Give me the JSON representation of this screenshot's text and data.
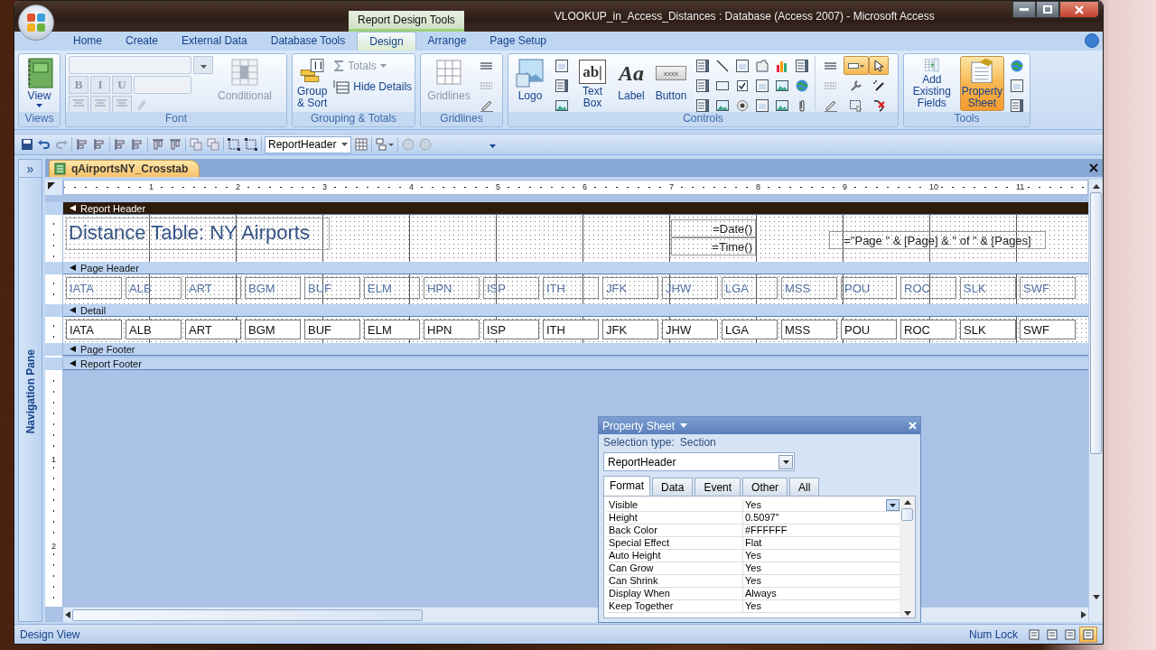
{
  "window": {
    "title": "VLOOKUP_in_Access_Distances : Database (Access 2007)  -  Microsoft Access",
    "context_tab": "Report Design Tools"
  },
  "ribbon_tabs": [
    {
      "label": "Home",
      "selected": false
    },
    {
      "label": "Create",
      "selected": false
    },
    {
      "label": "External Data",
      "selected": false
    },
    {
      "label": "Database Tools",
      "selected": false
    },
    {
      "label": "Design",
      "selected": true
    },
    {
      "label": "Arrange",
      "selected": false
    },
    {
      "label": "Page Setup",
      "selected": false
    }
  ],
  "ribbon_groups": [
    {
      "kind": "views",
      "title": "Views",
      "buttons": [
        {
          "kind": "view",
          "label": "View",
          "disabled": false,
          "selected": false
        }
      ]
    },
    {
      "kind": "font",
      "title": "Font",
      "disabled": true,
      "styles": [
        "B",
        "I",
        "U"
      ],
      "buttons": [
        {
          "kind": "conditional",
          "label": "Conditional",
          "disabled": true,
          "selected": false
        }
      ]
    },
    {
      "kind": "grouping",
      "title": "Grouping & Totals",
      "buttons": [
        {
          "kind": "group-sort",
          "label": "Group\n& Sort",
          "disabled": false,
          "selected": false
        }
      ],
      "small_buttons": [
        {
          "kind": "totals",
          "label": "Totals",
          "disabled": true
        },
        {
          "kind": "hide-details",
          "label": "Hide Details",
          "disabled": false
        }
      ]
    },
    {
      "kind": "gridlines",
      "title": "Gridlines",
      "buttons": [
        {
          "kind": "gridlines",
          "label": "Gridlines",
          "disabled": true,
          "selected": false
        }
      ]
    },
    {
      "kind": "controls",
      "title": "Controls",
      "buttons": [
        {
          "kind": "logo",
          "label": "Logo",
          "disabled": false,
          "selected": false
        },
        {
          "kind": "text-box",
          "label": "Text\nBox",
          "glyph": "ab|",
          "disabled": false,
          "selected": false
        },
        {
          "kind": "label",
          "label": "Label",
          "glyph": "Aa",
          "disabled": false,
          "selected": false
        },
        {
          "kind": "button",
          "label": "Button",
          "glyph": "xxxx",
          "disabled": false,
          "selected": false
        }
      ],
      "tools": [
        {
          "kind": "list",
          "selected": false
        },
        {
          "kind": "line",
          "selected": false
        },
        {
          "kind": "frame",
          "selected": false
        },
        {
          "kind": "tab",
          "selected": false
        },
        {
          "kind": "chart",
          "selected": false
        },
        {
          "kind": "list",
          "selected": false
        },
        {
          "kind": "list",
          "selected": false
        },
        {
          "kind": "rectangle",
          "selected": false
        },
        {
          "kind": "checkbox",
          "selected": false
        },
        {
          "kind": "frame",
          "selected": false
        },
        {
          "kind": "image",
          "selected": false
        },
        {
          "kind": "globe",
          "selected": false
        },
        {
          "kind": "list",
          "selected": false
        },
        {
          "kind": "image",
          "selected": false
        },
        {
          "kind": "option",
          "selected": false
        },
        {
          "kind": "frame",
          "selected": false
        },
        {
          "kind": "image",
          "selected": false
        },
        {
          "kind": "clip",
          "selected": false
        }
      ],
      "format_tools": [
        {
          "kind": "lines",
          "selected": false
        },
        {
          "kind": "wizard",
          "selected": true
        },
        {
          "kind": "pointer",
          "selected": true
        },
        {
          "kind": "dashes",
          "selected": false
        },
        {
          "kind": "wrench",
          "selected": false
        },
        {
          "kind": "wand",
          "selected": false
        },
        {
          "kind": "pen",
          "selected": false
        },
        {
          "kind": "region",
          "selected": false
        },
        {
          "kind": "remove",
          "selected": false
        }
      ]
    },
    {
      "kind": "tools",
      "title": "Tools",
      "buttons": [
        {
          "kind": "add-fields",
          "label": "Add Existing\nFields",
          "disabled": false,
          "selected": false
        },
        {
          "kind": "property-sheet",
          "label": "Property\nSheet",
          "disabled": false,
          "selected": true
        }
      ]
    }
  ],
  "toolbar": {
    "object_selector": "ReportHeader"
  },
  "navigation_pane": {
    "toggle": "»",
    "label": "Navigation Pane"
  },
  "document_tab": {
    "title": "qAirportsNY_Crosstab"
  },
  "ruler": {
    "horizontal": [
      "1",
      "2",
      "3",
      "4",
      "5",
      "6",
      "7",
      "8",
      "9",
      "10",
      "11"
    ],
    "vertical": [
      "1",
      "2"
    ]
  },
  "sections": [
    {
      "kind": "header",
      "title": "Report Header",
      "selected": true,
      "heading": "Distance Table: NY Airports",
      "fields": [
        "=Date()",
        "=Time()"
      ],
      "page_expression": "=\"Page \" & [Page] & \" of \" & [Pages]"
    },
    {
      "kind": "labels",
      "title": "Page Header",
      "selected": false,
      "cells": [
        "IATA",
        "ALB",
        "ART",
        "BGM",
        "BUF",
        "ELM",
        "HPN",
        "ISP",
        "ITH",
        "JFK",
        "JHW",
        "LGA",
        "MSS",
        "POU",
        "ROC",
        "SLK",
        "SWF"
      ]
    },
    {
      "kind": "text-boxes",
      "title": "Detail",
      "selected": false,
      "cells": [
        "IATA",
        "ALB",
        "ART",
        "BGM",
        "BUF",
        "ELM",
        "HPN",
        "ISP",
        "ITH",
        "JFK",
        "JHW",
        "LGA",
        "MSS",
        "POU",
        "ROC",
        "SLK",
        "SWF"
      ]
    },
    {
      "kind": "empty",
      "title": "Page Footer",
      "selected": false
    },
    {
      "kind": "empty",
      "title": "Report Footer",
      "selected": false
    }
  ],
  "property_sheet": {
    "title": "Property Sheet",
    "selection_label": "Selection type:",
    "selection_value": "Section",
    "object": "ReportHeader",
    "tabs": [
      {
        "label": "Format",
        "selected": true
      },
      {
        "label": "Data",
        "selected": false
      },
      {
        "label": "Event",
        "selected": false
      },
      {
        "label": "Other",
        "selected": false
      },
      {
        "label": "All",
        "selected": false
      }
    ],
    "properties": [
      {
        "name": "Visible",
        "value": "Yes",
        "selected": true
      },
      {
        "name": "Height",
        "value": "0.5097\"",
        "selected": false
      },
      {
        "name": "Back Color",
        "value": "#FFFFFF",
        "selected": false
      },
      {
        "name": "Special Effect",
        "value": "Flat",
        "selected": false
      },
      {
        "name": "Auto Height",
        "value": "Yes",
        "selected": false
      },
      {
        "name": "Can Grow",
        "value": "Yes",
        "selected": false
      },
      {
        "name": "Can Shrink",
        "value": "Yes",
        "selected": false
      },
      {
        "name": "Display When",
        "value": "Always",
        "selected": false
      },
      {
        "name": "Keep Together",
        "value": "Yes",
        "selected": false
      }
    ]
  },
  "status_bar": {
    "mode": "Design View",
    "indicator": "Num Lock",
    "views": [
      {
        "selected": false
      },
      {
        "selected": false
      },
      {
        "selected": false
      },
      {
        "selected": true
      }
    ]
  }
}
